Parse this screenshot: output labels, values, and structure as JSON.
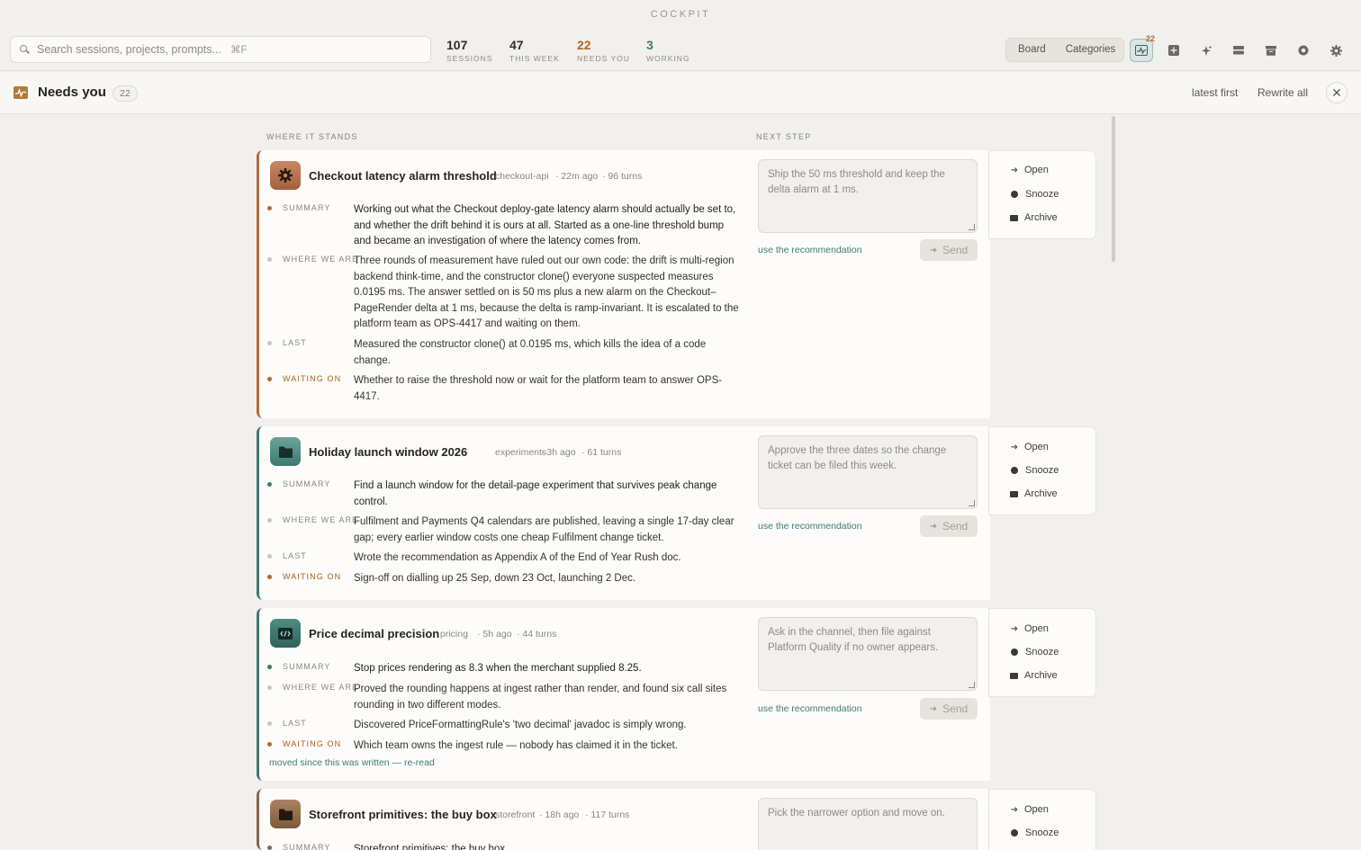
{
  "app": {
    "title": "COCKPIT"
  },
  "search": {
    "placeholder": "Search sessions, projects, prompts...",
    "shortcut": "⌘F"
  },
  "stats": [
    {
      "value": "107",
      "label": "SESSIONS"
    },
    {
      "value": "47",
      "label": "THIS WEEK"
    },
    {
      "value": "22",
      "label": "NEEDS YOU"
    },
    {
      "value": "3",
      "label": "WORKING"
    }
  ],
  "view_switch": {
    "board": "Board",
    "categories": "Categories"
  },
  "toolbar": {
    "needs_badge": "22"
  },
  "panel": {
    "title": "Needs you",
    "count": "22",
    "sort": "latest first",
    "rewrite": "Rewrite all"
  },
  "columns": {
    "left": "WHERE IT STANDS",
    "right": "NEXT STEP"
  },
  "labels": {
    "summary": "SUMMARY",
    "where": "WHERE WE ARE",
    "last": "LAST",
    "waiting": "WAITING ON",
    "use_rec": "use the recommendation",
    "send": "Send",
    "open": "Open",
    "snooze": "Snooze",
    "archive": "Archive",
    "moved": "moved since this was written — re-read"
  },
  "cards": [
    {
      "title": "Checkout latency alarm threshold",
      "project": "checkout-api",
      "age": "· 22m ago",
      "turns": "· 96 turns",
      "summary": "Working out what the Checkout deploy-gate latency alarm should actually be set to, and whether the drift behind it is ours at all. Started as a one-line threshold bump and became an investigation of where the latency comes from.",
      "where": "Three rounds of measurement have ruled out our own code: the drift is multi-region backend think-time, and the constructor clone() everyone suspected measures 0.0195 ms. The answer settled on is 50 ms plus a new alarm on the Checkout–PageRender delta at 1 ms, because the delta is ramp-invariant. It is escalated to the platform team as OPS-4417 and waiting on them.",
      "last": "Measured the constructor clone() at 0.0195 ms, which kills the idea of a code change.",
      "waiting": "Whether to raise the threshold now or wait for the platform team to answer OPS-4417.",
      "next": "Ship the 50 ms threshold and keep the delta alarm at 1 ms."
    },
    {
      "title": "Holiday launch window 2026",
      "project": "experiments",
      "age": "· 3h ago",
      "turns": "· 61 turns",
      "summary": "Find a launch window for the detail-page experiment that survives peak change control.",
      "where": "Fulfilment and Payments Q4 calendars are published, leaving a single 17-day clear gap; every earlier window costs one cheap Fulfilment change ticket.",
      "last": "Wrote the recommendation as Appendix A of the End of Year Rush doc.",
      "waiting": "Sign-off on dialling up 25 Sep, down 23 Oct, launching 2 Dec.",
      "next": "Approve the three dates so the change ticket can be filed this week."
    },
    {
      "title": "Price decimal precision",
      "project": "pricing",
      "age": "· 5h ago",
      "turns": "· 44 turns",
      "summary": "Stop prices rendering as 8.3 when the merchant supplied 8.25.",
      "where": "Proved the rounding happens at ingest rather than render, and found six call sites rounding in two different modes.",
      "last": "Discovered PriceFormattingRule's 'two decimal' javadoc is simply wrong.",
      "waiting": "Which team owns the ingest rule — nobody has claimed it in the ticket.",
      "next": "Ask in the channel, then file against Platform Quality if no owner appears."
    },
    {
      "title": "Storefront primitives: the buy box",
      "project": "storefront",
      "age": "· 18h ago",
      "turns": "· 117 turns",
      "summary": "Storefront primitives: the buy box",
      "next": "Pick the narrower option and move on."
    }
  ]
}
